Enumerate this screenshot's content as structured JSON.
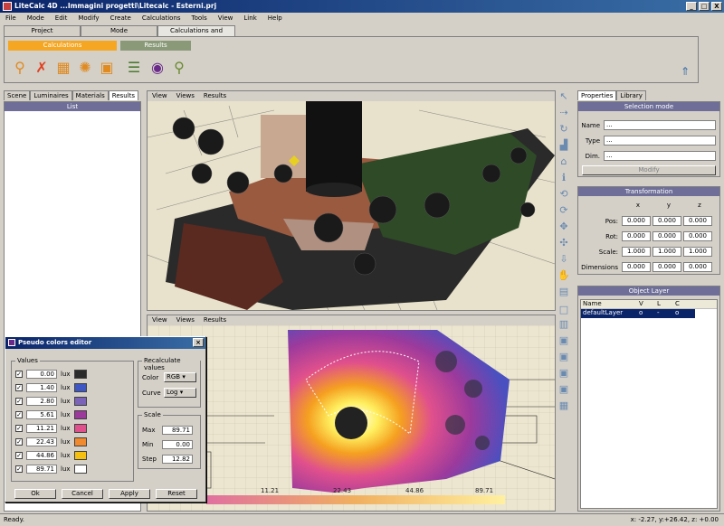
{
  "window": {
    "title": "LiteCalc 4D    ...Immagini progetti\\Litecalc - Esterni.prj",
    "min": "_",
    "max": "□",
    "close": "X"
  },
  "menu": [
    "File",
    "Mode",
    "Edit",
    "Modify",
    "Create",
    "Calculations",
    "Tools",
    "View",
    "Link",
    "Help"
  ],
  "top_tabs": [
    "Project",
    "Mode",
    "Calculations and Results"
  ],
  "ribbon": {
    "calc_group": "Calculations",
    "results_group": "Results"
  },
  "left_panel": {
    "tabs": [
      "Scene",
      "Luminaires",
      "Materials",
      "Results"
    ],
    "list_header": "List"
  },
  "viewport_menu": [
    "View",
    "Views",
    "Results"
  ],
  "right_panel": {
    "tabs": [
      "Properties",
      "Library"
    ],
    "selection_header": "Selection mode",
    "name_label": "Name",
    "type_label": "Type",
    "dim_label": "Dim.",
    "name_value": "...",
    "type_value": "...",
    "dim_value": "...",
    "modify_button": "Modify",
    "transform_header": "Transformation",
    "axes": [
      "x",
      "y",
      "z"
    ],
    "rows": [
      {
        "label": "Pos:",
        "values": [
          "0.000",
          "0.000",
          "0.000"
        ]
      },
      {
        "label": "Rot:",
        "values": [
          "0.000",
          "0.000",
          "0.000"
        ]
      },
      {
        "label": "Scale:",
        "values": [
          "1.000",
          "1.000",
          "1.000"
        ]
      },
      {
        "label": "Dimensions",
        "values": [
          "0.000",
          "0.000",
          "0.000"
        ]
      }
    ],
    "layer_header": "Object Layer",
    "layer_cols": [
      "Name",
      "V",
      "L",
      "C"
    ],
    "layer_row": {
      "name": "defaultLayer",
      "v": "o",
      "l": "-",
      "c": "o"
    }
  },
  "dialog": {
    "title": "Pseudo colors editor",
    "values_group": "Values",
    "unit": "lux",
    "values": [
      {
        "value": "0.00",
        "color": "#2b2b2b"
      },
      {
        "value": "1.40",
        "color": "#3d56c4"
      },
      {
        "value": "2.80",
        "color": "#7a63b8"
      },
      {
        "value": "5.61",
        "color": "#9c3a9c"
      },
      {
        "value": "11.21",
        "color": "#e0508c"
      },
      {
        "value": "22.43",
        "color": "#f08a2c"
      },
      {
        "value": "44.86",
        "color": "#f5c010"
      },
      {
        "value": "89.71",
        "color": "#ffffff"
      }
    ],
    "recalc_group": "Recalculate values",
    "color_label": "Color",
    "color_value": "RGB",
    "curve_label": "Curve",
    "curve_value": "Log",
    "scale_group": "Scale",
    "max_label": "Max",
    "max_value": "89.71",
    "min_label": "Min",
    "min_value": "0.00",
    "step_label": "Step",
    "step_value": "12.82",
    "buttons": {
      "ok": "Ok",
      "cancel": "Cancel",
      "apply": "Apply",
      "reset": "Reset"
    }
  },
  "legend_ticks": [
    "11.21",
    "22.43",
    "44.86",
    "89.71"
  ],
  "status": {
    "left": "Ready.",
    "coords": "x: -2.27, y:+26.42, z: +0.00"
  }
}
